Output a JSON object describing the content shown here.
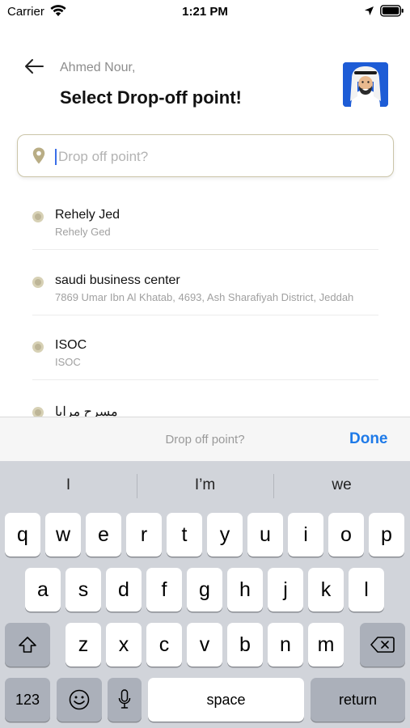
{
  "status_bar": {
    "carrier": "Carrier",
    "time": "1:21 PM"
  },
  "header": {
    "greeting": "Ahmed Nour,",
    "title": "Select Drop-off point!"
  },
  "search": {
    "placeholder": "Drop off point?",
    "value": ""
  },
  "results": [
    {
      "title": "Rehely Jed",
      "subtitle": "Rehely Ged"
    },
    {
      "title": "saudi business center",
      "subtitle": "7869 Umar Ibn Al Khatab, 4693, Ash Sharafiyah District, Jeddah"
    },
    {
      "title": "ISOC",
      "subtitle": "ISOC"
    },
    {
      "title": "مسرح مرايا",
      "subtitle": ""
    }
  ],
  "accessory": {
    "placeholder": "Drop off point?",
    "done_label": "Done"
  },
  "keyboard": {
    "suggestions": [
      "I",
      "I’m",
      "we"
    ],
    "row1": [
      "q",
      "w",
      "e",
      "r",
      "t",
      "y",
      "u",
      "i",
      "o",
      "p"
    ],
    "row2": [
      "a",
      "s",
      "d",
      "f",
      "g",
      "h",
      "j",
      "k",
      "l"
    ],
    "row3": [
      "z",
      "x",
      "c",
      "v",
      "b",
      "n",
      "m"
    ],
    "numbers_label": "123",
    "space_label": "space",
    "return_label": "return"
  },
  "colors": {
    "accent": "#1e7ae8",
    "marker": "#bdb597",
    "search_border": "#cbc5a8",
    "keyboard_bg": "#d1d4da"
  },
  "icons": [
    "wifi-icon",
    "location-arrow-icon",
    "battery-icon",
    "back-arrow-icon",
    "map-pin-icon",
    "shift-icon",
    "delete-icon",
    "emoji-icon",
    "microphone-icon"
  ]
}
